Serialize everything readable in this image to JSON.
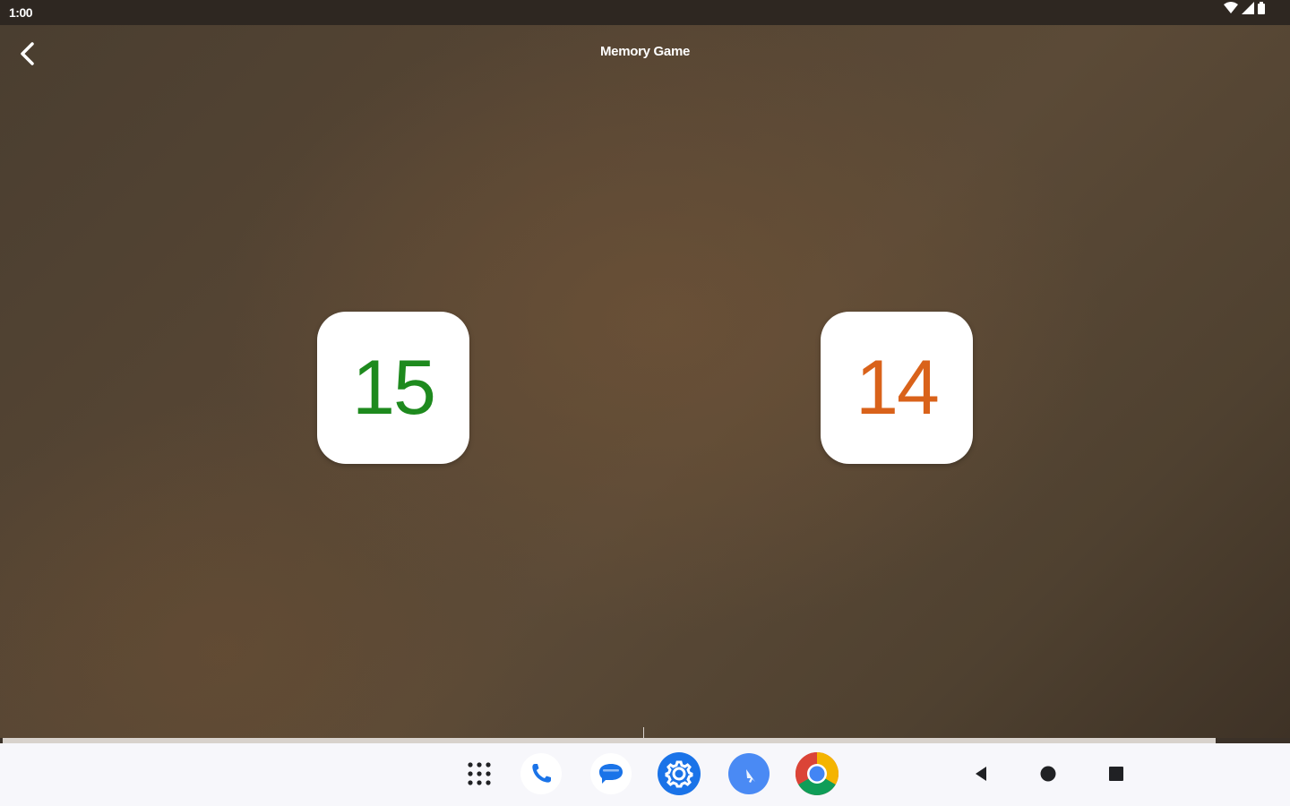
{
  "status_bar": {
    "time": "1:00",
    "icons": [
      "wifi-icon",
      "signal-icon",
      "battery-icon"
    ]
  },
  "app": {
    "title": "Memory Game",
    "back_icon": "back-arrow-icon"
  },
  "cards": [
    {
      "value": "15",
      "color": "#1e8a1e"
    },
    {
      "value": "14",
      "color": "#d9621a"
    }
  ],
  "progress": {
    "fraction": 0.94
  },
  "dock": {
    "apps": [
      "app-drawer-icon",
      "phone-icon",
      "messages-icon",
      "settings-icon",
      "cursor-app-icon",
      "chrome-icon"
    ]
  },
  "nav": {
    "buttons": [
      "nav-back-icon",
      "nav-home-icon",
      "nav-recents-icon"
    ]
  },
  "colors": {
    "status_bar": "#2e2721",
    "background": "#574634",
    "nav_bar": "#f7f7fb",
    "accent_blue": "#1a73e8"
  }
}
